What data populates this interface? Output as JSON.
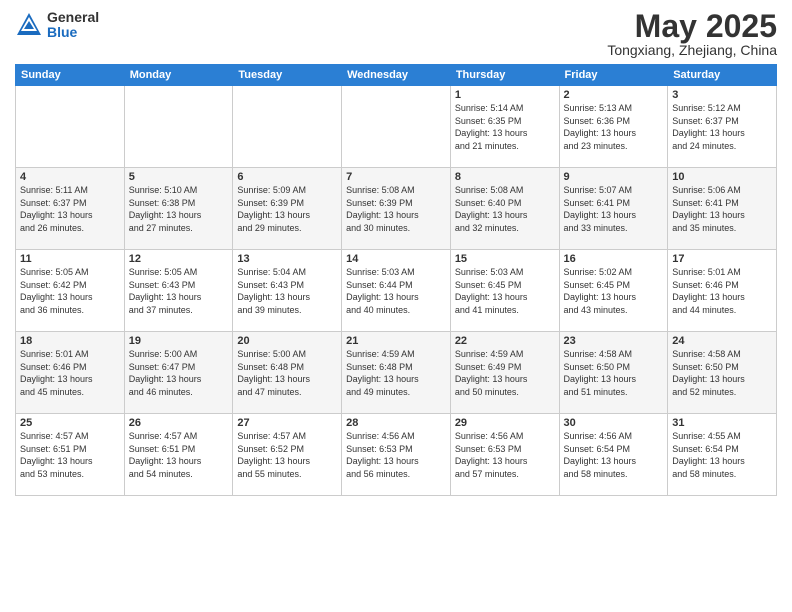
{
  "logo": {
    "general": "General",
    "blue": "Blue"
  },
  "title": "May 2025",
  "subtitle": "Tongxiang, Zhejiang, China",
  "days_of_week": [
    "Sunday",
    "Monday",
    "Tuesday",
    "Wednesday",
    "Thursday",
    "Friday",
    "Saturday"
  ],
  "weeks": [
    [
      {
        "day": "",
        "info": ""
      },
      {
        "day": "",
        "info": ""
      },
      {
        "day": "",
        "info": ""
      },
      {
        "day": "",
        "info": ""
      },
      {
        "day": "1",
        "info": "Sunrise: 5:14 AM\nSunset: 6:35 PM\nDaylight: 13 hours\nand 21 minutes."
      },
      {
        "day": "2",
        "info": "Sunrise: 5:13 AM\nSunset: 6:36 PM\nDaylight: 13 hours\nand 23 minutes."
      },
      {
        "day": "3",
        "info": "Sunrise: 5:12 AM\nSunset: 6:37 PM\nDaylight: 13 hours\nand 24 minutes."
      }
    ],
    [
      {
        "day": "4",
        "info": "Sunrise: 5:11 AM\nSunset: 6:37 PM\nDaylight: 13 hours\nand 26 minutes."
      },
      {
        "day": "5",
        "info": "Sunrise: 5:10 AM\nSunset: 6:38 PM\nDaylight: 13 hours\nand 27 minutes."
      },
      {
        "day": "6",
        "info": "Sunrise: 5:09 AM\nSunset: 6:39 PM\nDaylight: 13 hours\nand 29 minutes."
      },
      {
        "day": "7",
        "info": "Sunrise: 5:08 AM\nSunset: 6:39 PM\nDaylight: 13 hours\nand 30 minutes."
      },
      {
        "day": "8",
        "info": "Sunrise: 5:08 AM\nSunset: 6:40 PM\nDaylight: 13 hours\nand 32 minutes."
      },
      {
        "day": "9",
        "info": "Sunrise: 5:07 AM\nSunset: 6:41 PM\nDaylight: 13 hours\nand 33 minutes."
      },
      {
        "day": "10",
        "info": "Sunrise: 5:06 AM\nSunset: 6:41 PM\nDaylight: 13 hours\nand 35 minutes."
      }
    ],
    [
      {
        "day": "11",
        "info": "Sunrise: 5:05 AM\nSunset: 6:42 PM\nDaylight: 13 hours\nand 36 minutes."
      },
      {
        "day": "12",
        "info": "Sunrise: 5:05 AM\nSunset: 6:43 PM\nDaylight: 13 hours\nand 37 minutes."
      },
      {
        "day": "13",
        "info": "Sunrise: 5:04 AM\nSunset: 6:43 PM\nDaylight: 13 hours\nand 39 minutes."
      },
      {
        "day": "14",
        "info": "Sunrise: 5:03 AM\nSunset: 6:44 PM\nDaylight: 13 hours\nand 40 minutes."
      },
      {
        "day": "15",
        "info": "Sunrise: 5:03 AM\nSunset: 6:45 PM\nDaylight: 13 hours\nand 41 minutes."
      },
      {
        "day": "16",
        "info": "Sunrise: 5:02 AM\nSunset: 6:45 PM\nDaylight: 13 hours\nand 43 minutes."
      },
      {
        "day": "17",
        "info": "Sunrise: 5:01 AM\nSunset: 6:46 PM\nDaylight: 13 hours\nand 44 minutes."
      }
    ],
    [
      {
        "day": "18",
        "info": "Sunrise: 5:01 AM\nSunset: 6:46 PM\nDaylight: 13 hours\nand 45 minutes."
      },
      {
        "day": "19",
        "info": "Sunrise: 5:00 AM\nSunset: 6:47 PM\nDaylight: 13 hours\nand 46 minutes."
      },
      {
        "day": "20",
        "info": "Sunrise: 5:00 AM\nSunset: 6:48 PM\nDaylight: 13 hours\nand 47 minutes."
      },
      {
        "day": "21",
        "info": "Sunrise: 4:59 AM\nSunset: 6:48 PM\nDaylight: 13 hours\nand 49 minutes."
      },
      {
        "day": "22",
        "info": "Sunrise: 4:59 AM\nSunset: 6:49 PM\nDaylight: 13 hours\nand 50 minutes."
      },
      {
        "day": "23",
        "info": "Sunrise: 4:58 AM\nSunset: 6:50 PM\nDaylight: 13 hours\nand 51 minutes."
      },
      {
        "day": "24",
        "info": "Sunrise: 4:58 AM\nSunset: 6:50 PM\nDaylight: 13 hours\nand 52 minutes."
      }
    ],
    [
      {
        "day": "25",
        "info": "Sunrise: 4:57 AM\nSunset: 6:51 PM\nDaylight: 13 hours\nand 53 minutes."
      },
      {
        "day": "26",
        "info": "Sunrise: 4:57 AM\nSunset: 6:51 PM\nDaylight: 13 hours\nand 54 minutes."
      },
      {
        "day": "27",
        "info": "Sunrise: 4:57 AM\nSunset: 6:52 PM\nDaylight: 13 hours\nand 55 minutes."
      },
      {
        "day": "28",
        "info": "Sunrise: 4:56 AM\nSunset: 6:53 PM\nDaylight: 13 hours\nand 56 minutes."
      },
      {
        "day": "29",
        "info": "Sunrise: 4:56 AM\nSunset: 6:53 PM\nDaylight: 13 hours\nand 57 minutes."
      },
      {
        "day": "30",
        "info": "Sunrise: 4:56 AM\nSunset: 6:54 PM\nDaylight: 13 hours\nand 58 minutes."
      },
      {
        "day": "31",
        "info": "Sunrise: 4:55 AM\nSunset: 6:54 PM\nDaylight: 13 hours\nand 58 minutes."
      }
    ]
  ]
}
